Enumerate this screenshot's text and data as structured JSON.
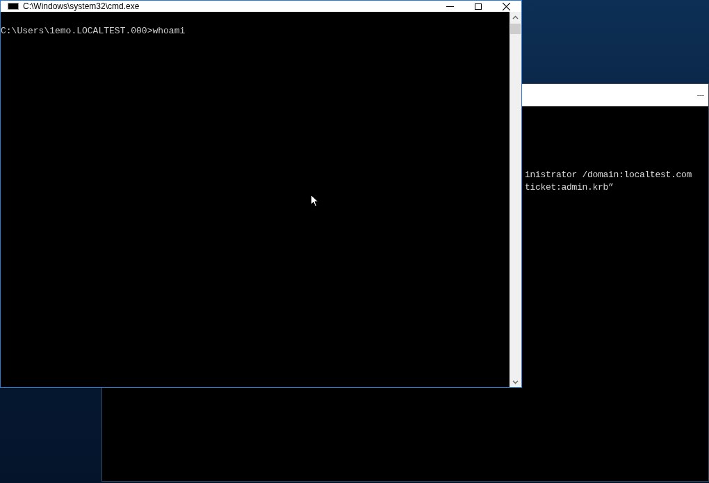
{
  "front_window": {
    "title": "C:\\Windows\\system32\\cmd.exe",
    "lines": [
      "C:\\Users\\1emo.LOCALTEST.000>whoami"
    ]
  },
  "back_window": {
    "lines": [
      "inistrator /domain:localtest.com",
      "ticket:admin.krb”"
    ]
  }
}
